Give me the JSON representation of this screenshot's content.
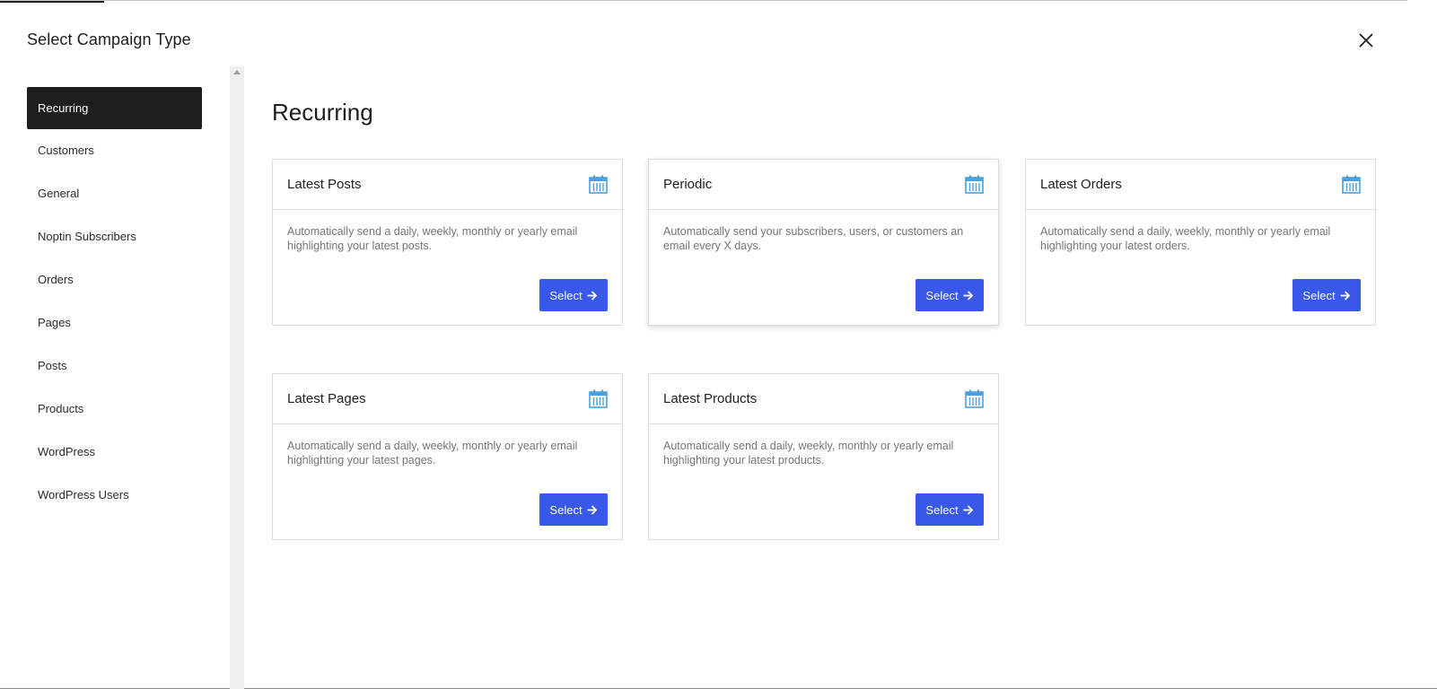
{
  "modal": {
    "title": "Select Campaign Type"
  },
  "sidebar": {
    "items": [
      {
        "label": "Recurring",
        "active": true
      },
      {
        "label": "Customers"
      },
      {
        "label": "General"
      },
      {
        "label": "Noptin Subscribers"
      },
      {
        "label": "Orders"
      },
      {
        "label": "Pages"
      },
      {
        "label": "Posts"
      },
      {
        "label": "Products"
      },
      {
        "label": "WordPress"
      },
      {
        "label": "WordPress Users"
      }
    ]
  },
  "main": {
    "heading": "Recurring",
    "cards": [
      {
        "title": "Latest Posts",
        "description": "Automatically send a daily, weekly, monthly or yearly email highlighting your latest posts.",
        "button": "Select",
        "icon": "calendar-icon"
      },
      {
        "title": "Periodic",
        "description": "Automatically send your subscribers, users, or customers an email every X days.",
        "button": "Select",
        "icon": "calendar-icon"
      },
      {
        "title": "Latest Orders",
        "description": "Automatically send a daily, weekly, monthly or yearly email highlighting your latest orders.",
        "button": "Select",
        "icon": "calendar-icon"
      },
      {
        "title": "Latest Pages",
        "description": "Automatically send a daily, weekly, monthly or yearly email highlighting your latest pages.",
        "button": "Select",
        "icon": "calendar-icon"
      },
      {
        "title": "Latest Products",
        "description": "Automatically send a daily, weekly, monthly or yearly email highlighting your latest products.",
        "button": "Select",
        "icon": "calendar-icon"
      }
    ]
  },
  "colors": {
    "accent": "#3858e9",
    "active_nav": "#1e1e1e",
    "icon_blue": "#4a9fe0"
  },
  "icons": {
    "close": "close-icon",
    "arrow": "arrow-right-icon"
  }
}
